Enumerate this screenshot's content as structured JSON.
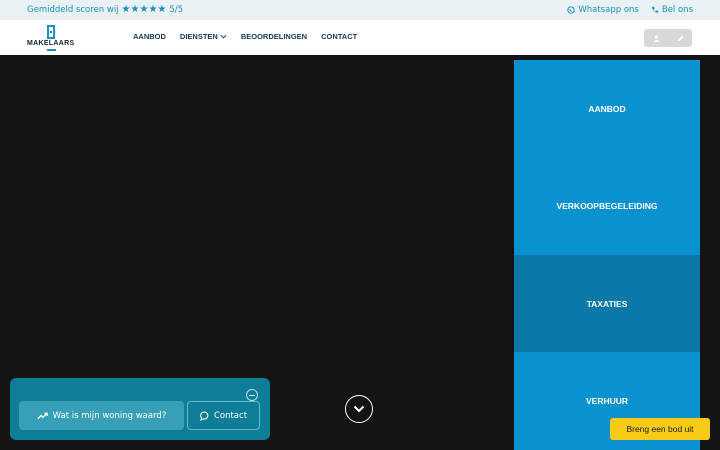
{
  "topbar": {
    "rating_text": "Gemiddeld scoren wij",
    "stars": "★★★★★",
    "score": "5/5",
    "whatsapp": "Whatsapp ons",
    "call": "Bel ons"
  },
  "logo": {
    "wordmark": "MAKELAARS"
  },
  "nav": {
    "items": [
      "AANBOD",
      "DIENSTEN",
      "BEOORDELINGEN",
      "CONTACT"
    ]
  },
  "panel": {
    "tiles": [
      {
        "label": "AANBOD",
        "color": "#0a91cf"
      },
      {
        "label": "VERKOOPBEGELEIDING",
        "color": "#0a91cf"
      },
      {
        "label": "TAXATIES",
        "color": "#0a79a8"
      },
      {
        "label": "VERHUUR",
        "color": "#0a91cf"
      }
    ]
  },
  "widget": {
    "value_button": "Wat is mijn woning waard?",
    "contact_button": "Contact"
  },
  "cta": {
    "label": "Breng een bod uit"
  },
  "colors": {
    "accent": "#1b8fc0",
    "hero_bg": "#141414",
    "cta": "#f7cb15"
  }
}
